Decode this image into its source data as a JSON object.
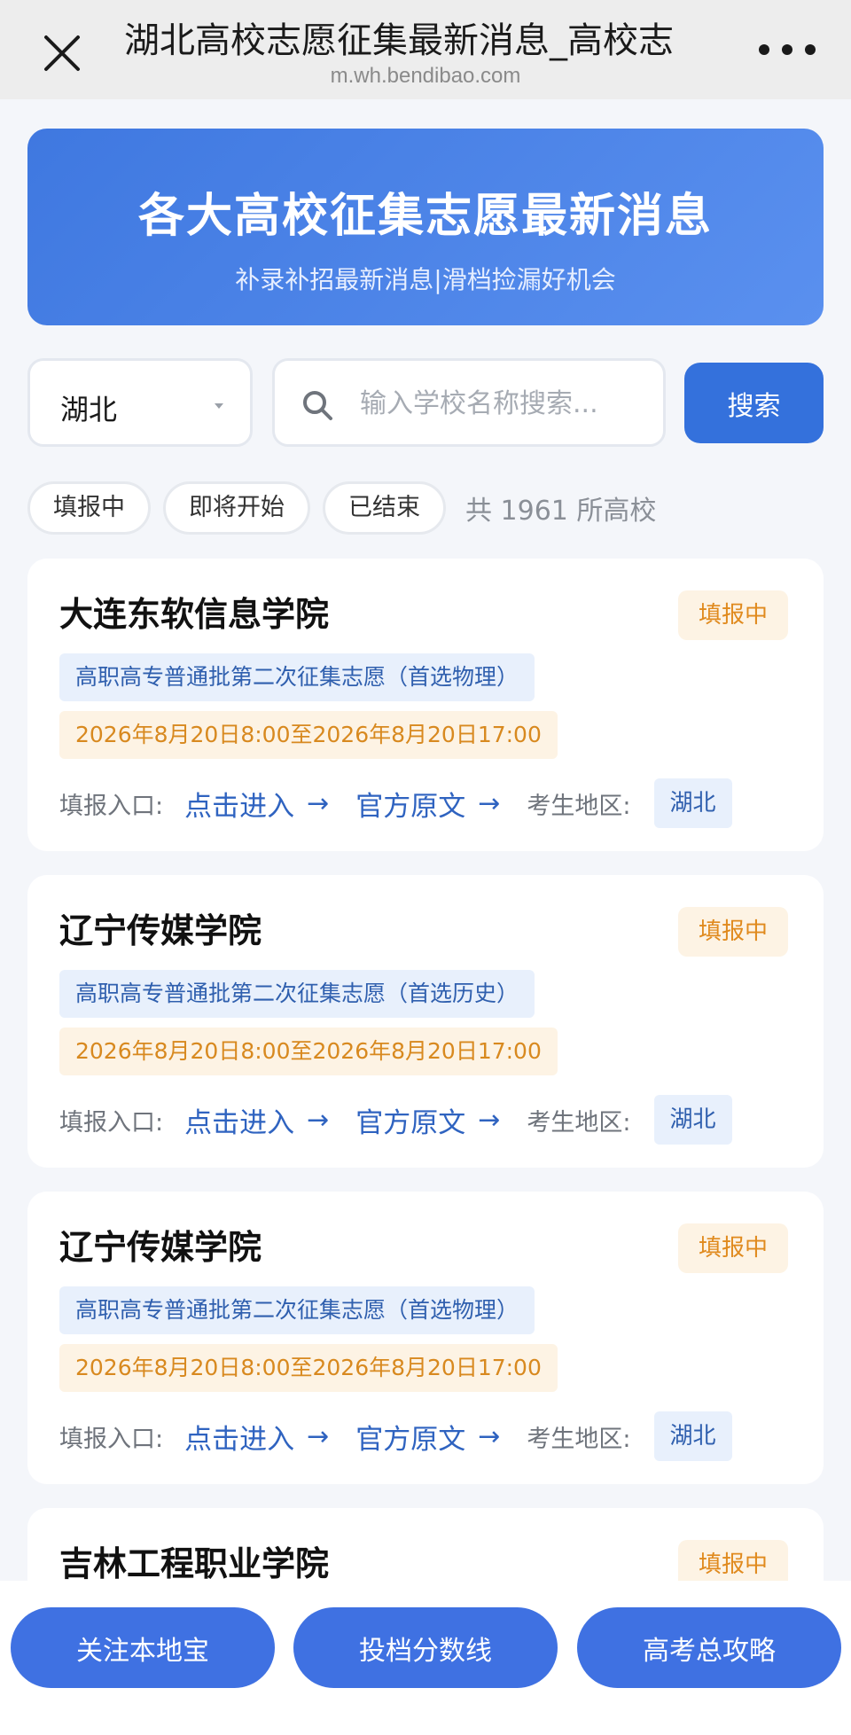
{
  "topbar": {
    "title": "湖北高校志愿征集最新消息_高校志",
    "url": "m.wh.bendibao.com"
  },
  "hero": {
    "title": "各大高校征集志愿最新消息",
    "subtitle": "补录补招最新消息|滑档捡漏好机会"
  },
  "search": {
    "region": "湖北",
    "placeholder": "输入学校名称搜索...",
    "button_label": "搜索"
  },
  "filters": {
    "chips": [
      "填报中",
      "即将开始",
      "已结束"
    ],
    "count_text": "共 1961 所高校"
  },
  "card_labels": {
    "entry_label": "填报入口:",
    "enter_link": "点击进入",
    "original_link": "官方原文",
    "region_label": "考生地区:",
    "arrow": "→"
  },
  "cards": [
    {
      "name": "大连东软信息学院",
      "status": "填报中",
      "batch": "高职高专普通批第二次征集志愿（首选物理）",
      "date": "2026年8月20日8:00至2026年8月20日17:00",
      "region": "湖北"
    },
    {
      "name": "辽宁传媒学院",
      "status": "填报中",
      "batch": "高职高专普通批第二次征集志愿（首选历史）",
      "date": "2026年8月20日8:00至2026年8月20日17:00",
      "region": "湖北"
    },
    {
      "name": "辽宁传媒学院",
      "status": "填报中",
      "batch": "高职高专普通批第二次征集志愿（首选物理）",
      "date": "2026年8月20日8:00至2026年8月20日17:00",
      "region": "湖北"
    },
    {
      "name": "吉林工程职业学院",
      "status": "填报中"
    }
  ],
  "bottom_nav": [
    "关注本地宝",
    "投档分数线",
    "高考总攻略"
  ],
  "colors": {
    "primary": "#3471dc",
    "badge_bg": "#fdf3e4",
    "badge_text": "#e08a1e",
    "tag_bg": "#e8f0fc",
    "tag_text": "#2f5fae"
  }
}
